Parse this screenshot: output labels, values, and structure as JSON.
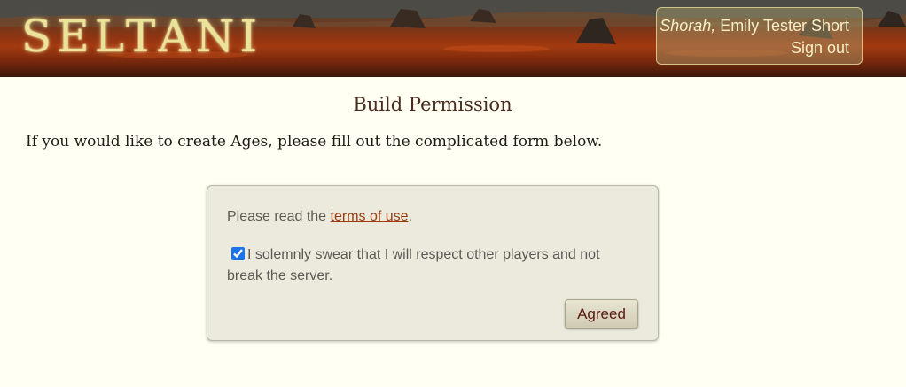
{
  "header": {
    "logo": "SELTANI",
    "user": {
      "greeting": "Shorah,",
      "name": "Emily Tester Short",
      "signout_label": "Sign out"
    }
  },
  "main": {
    "title": "Build Permission",
    "intro": "If you would like to create Ages, please fill out the complicated form below."
  },
  "form": {
    "terms_prefix": "Please read the ",
    "terms_link": "terms of use",
    "terms_suffix": ".",
    "oath_checked": true,
    "oath_text": "I solemnly swear that I will respect other players and not break the server.",
    "submit_label": "Agreed"
  },
  "colors": {
    "accent_link": "#9a3a10",
    "page_bg": "#fffff4",
    "logo": "#ece39a"
  }
}
